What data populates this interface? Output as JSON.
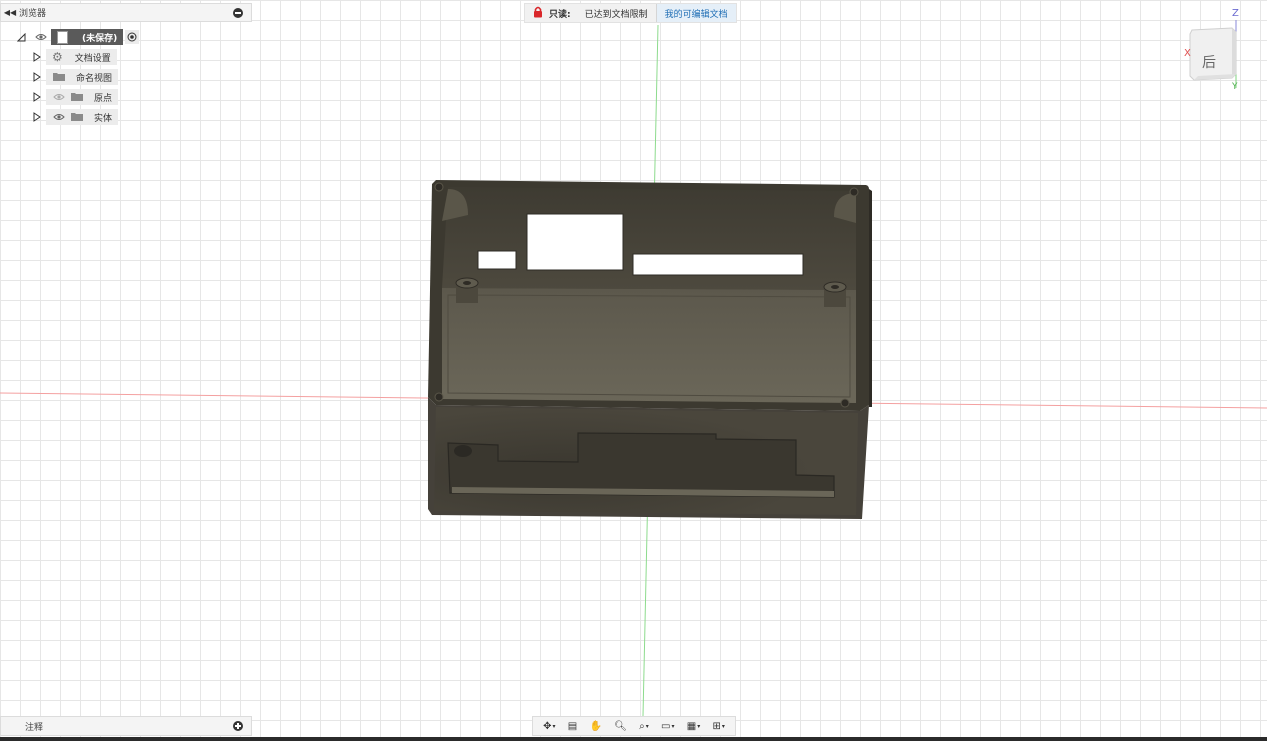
{
  "browser": {
    "title": "浏览器",
    "collapse_icon": "double-chevron-left-icon",
    "root": {
      "label": "(未保存)"
    },
    "items": [
      {
        "label": "文档设置",
        "icon": "gear-icon"
      },
      {
        "label": "命名视图",
        "icon": "folder-icon"
      },
      {
        "label": "原点",
        "icon": "folder-icon"
      },
      {
        "label": "实体",
        "icon": "folder-icon"
      }
    ]
  },
  "readonly_banner": {
    "prefix": "只读:",
    "message": "已达到文档限制",
    "link": "我的可编辑文档",
    "lock_color": "#d9262a"
  },
  "viewcube": {
    "face_label": "后",
    "axis_z": "Z",
    "axis_x": "X",
    "axis_y": "Y"
  },
  "notes": {
    "label": "注释"
  },
  "nav_toolbar": {
    "items": [
      "orbit-icon",
      "look-at-icon",
      "pan-icon",
      "zoom-icon",
      "fit-icon",
      "display-settings-icon",
      "grid-icon",
      "viewports-icon"
    ]
  },
  "colors": {
    "model_body": "#4a463c",
    "grid": "#e6e6e6",
    "axis_red": "#f08080",
    "axis_green": "#7fd37f"
  }
}
